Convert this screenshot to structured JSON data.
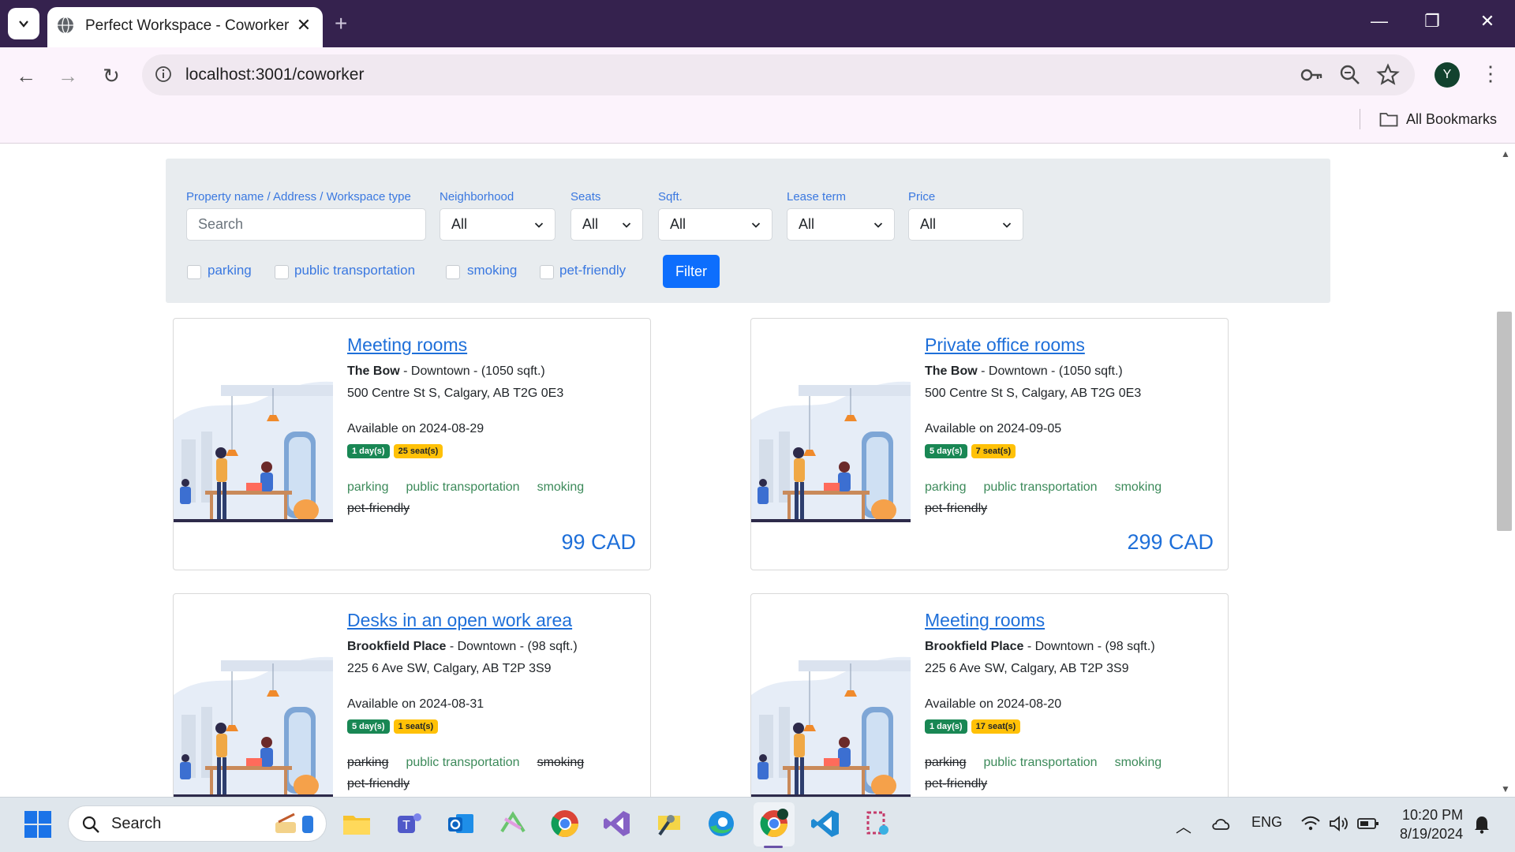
{
  "browser": {
    "tab_title": "Perfect Workspace - Coworker",
    "url": "localhost:3001/coworker",
    "avatar_letter": "Y",
    "bookmarks_label": "All Bookmarks"
  },
  "filters": {
    "labels": {
      "search": "Property name / Address / Workspace type",
      "neighborhood": "Neighborhood",
      "seats": "Seats",
      "sqft": "Sqft.",
      "lease": "Lease term",
      "price": "Price"
    },
    "search_placeholder": "Search",
    "neighborhood_value": "All",
    "seats_value": "All",
    "sqft_value": "All",
    "lease_value": "All",
    "price_value": "All",
    "checkboxes": [
      "parking",
      "public transportation",
      "smoking",
      "pet-friendly"
    ],
    "filter_button": "Filter"
  },
  "listings": [
    {
      "title": "Meeting rooms",
      "building": "The Bow",
      "meta": " - Downtown - (1050 sqft.)",
      "address": "500 Centre St S, Calgary, AB T2G 0E3",
      "available": "Available on 2024-08-29",
      "days_badge": "1 day(s)",
      "seats_badge": "25 seat(s)",
      "amenities": [
        {
          "label": "parking",
          "available": true
        },
        {
          "label": "public transportation",
          "available": true
        },
        {
          "label": "smoking",
          "available": true
        },
        {
          "label": "pet-friendly",
          "available": false
        }
      ],
      "price": "99 CAD"
    },
    {
      "title": "Private office rooms",
      "building": "The Bow",
      "meta": " - Downtown - (1050 sqft.)",
      "address": "500 Centre St S, Calgary, AB T2G 0E3",
      "available": "Available on 2024-09-05",
      "days_badge": "5 day(s)",
      "seats_badge": "7 seat(s)",
      "amenities": [
        {
          "label": "parking",
          "available": true
        },
        {
          "label": "public transportation",
          "available": true
        },
        {
          "label": "smoking",
          "available": true
        },
        {
          "label": "pet-friendly",
          "available": false
        }
      ],
      "price": "299 CAD"
    },
    {
      "title": "Desks in an open work area",
      "building": "Brookfield Place",
      "meta": " - Downtown - (98 sqft.)",
      "address": "225 6 Ave SW, Calgary, AB T2P 3S9",
      "available": "Available on 2024-08-31",
      "days_badge": "5 day(s)",
      "seats_badge": "1 seat(s)",
      "amenities": [
        {
          "label": "parking",
          "available": false
        },
        {
          "label": "public transportation",
          "available": true
        },
        {
          "label": "smoking",
          "available": false
        },
        {
          "label": "pet-friendly",
          "available": false
        }
      ],
      "price": ""
    },
    {
      "title": "Meeting rooms",
      "building": "Brookfield Place",
      "meta": " - Downtown - (98 sqft.)",
      "address": "225 6 Ave SW, Calgary, AB T2P 3S9",
      "available": "Available on 2024-08-20",
      "days_badge": "1 day(s)",
      "seats_badge": "17 seat(s)",
      "amenities": [
        {
          "label": "parking",
          "available": false
        },
        {
          "label": "public transportation",
          "available": true
        },
        {
          "label": "smoking",
          "available": true
        },
        {
          "label": "pet-friendly",
          "available": false
        }
      ],
      "price": ""
    }
  ],
  "taskbar": {
    "search_text": "Search",
    "language": "ENG",
    "time": "10:20 PM",
    "date": "8/19/2024"
  }
}
